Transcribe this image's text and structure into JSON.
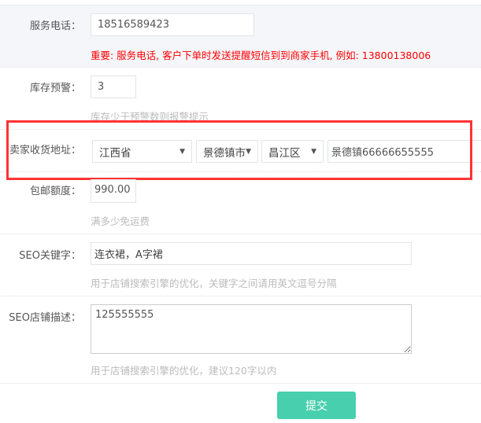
{
  "phone": {
    "label": "服务电话：",
    "value": "18516589423",
    "notice": "重要: 服务电话, 客户下单时发送提醒短信到到商家手机, 例如: 13800138006"
  },
  "stock": {
    "label": "库存预警：",
    "value": "3",
    "hint": "库存少于预警数则报警提示"
  },
  "address": {
    "label": "卖家收货地址：",
    "province": "江西省",
    "city": "景德镇市",
    "district": "昌江区",
    "detail": "景德镇66666655555",
    "arrow": "▼"
  },
  "shipping": {
    "label": "包邮额度：",
    "value": "990.00",
    "hint": "满多少免运费"
  },
  "seo_keywords": {
    "label": "SEO关键字：",
    "value": "连衣裙，A字裙",
    "hint": "用于店铺搜索引擎的优化，关键字之间请用英文逗号分隔"
  },
  "seo_desc": {
    "label": "SEO店铺描述：",
    "value": "125555555",
    "hint": "用于店铺搜索引擎的优化，建议120字以内"
  },
  "submit_label": "提交",
  "colors": {
    "accent": "#48cfad",
    "notice": "#ff0000",
    "highlight": "#ff3333"
  }
}
